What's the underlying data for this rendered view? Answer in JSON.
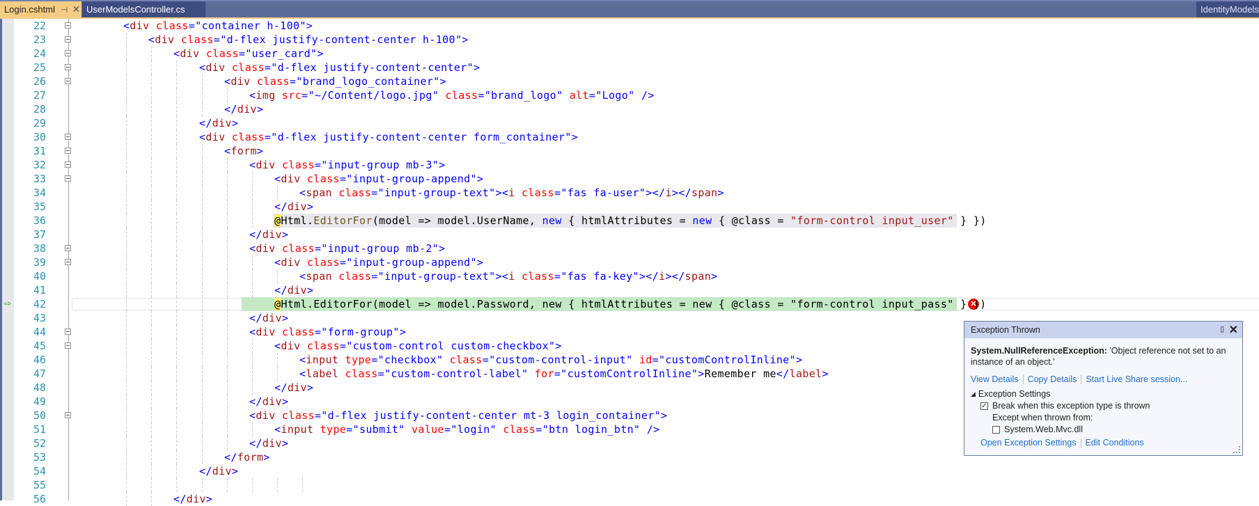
{
  "tabs": {
    "active": {
      "label": "Login.cshtml",
      "pin_icon": "pin-icon",
      "close_icon": "close-icon"
    },
    "second": {
      "label": "UserModelsController.cs"
    },
    "right": {
      "label": "IdentityModels.cs"
    }
  },
  "editor": {
    "current_line": 42,
    "lines": [
      {
        "n": "22",
        "indent": 0,
        "fold": true,
        "tokens": [
          [
            "tg",
            "<"
          ],
          [
            "tn",
            "div"
          ],
          [
            "at",
            " class"
          ],
          [
            "tg",
            "="
          ],
          [
            "av",
            "\"container h-100\""
          ],
          [
            "tg",
            ">"
          ]
        ]
      },
      {
        "n": "23",
        "indent": 1,
        "fold": true,
        "tokens": [
          [
            "tg",
            "<"
          ],
          [
            "tn",
            "div"
          ],
          [
            "at",
            " class"
          ],
          [
            "tg",
            "="
          ],
          [
            "av",
            "\"d-flex justify-content-center h-100\""
          ],
          [
            "tg",
            ">"
          ]
        ]
      },
      {
        "n": "24",
        "indent": 2,
        "fold": true,
        "tokens": [
          [
            "tg",
            "<"
          ],
          [
            "tn",
            "div"
          ],
          [
            "at",
            " class"
          ],
          [
            "tg",
            "="
          ],
          [
            "av",
            "\"user_card\""
          ],
          [
            "tg",
            ">"
          ]
        ]
      },
      {
        "n": "25",
        "indent": 3,
        "fold": true,
        "tokens": [
          [
            "tg",
            "<"
          ],
          [
            "tn",
            "div"
          ],
          [
            "at",
            " class"
          ],
          [
            "tg",
            "="
          ],
          [
            "av",
            "\"d-flex justify-content-center\""
          ],
          [
            "tg",
            ">"
          ]
        ]
      },
      {
        "n": "26",
        "indent": 4,
        "fold": true,
        "tokens": [
          [
            "tg",
            "<"
          ],
          [
            "tn",
            "div"
          ],
          [
            "at",
            " class"
          ],
          [
            "tg",
            "="
          ],
          [
            "av",
            "\"brand_logo_container\""
          ],
          [
            "tg",
            ">"
          ]
        ]
      },
      {
        "n": "27",
        "indent": 5,
        "fold": false,
        "tokens": [
          [
            "tg",
            "<"
          ],
          [
            "tn",
            "img"
          ],
          [
            "at",
            " src"
          ],
          [
            "tg",
            "="
          ],
          [
            "av",
            "\"~/Content/logo.jpg\""
          ],
          [
            "at",
            " class"
          ],
          [
            "tg",
            "="
          ],
          [
            "av",
            "\"brand_logo\""
          ],
          [
            "at",
            " alt"
          ],
          [
            "tg",
            "="
          ],
          [
            "av",
            "\"Logo\""
          ],
          [
            "tg",
            " />"
          ]
        ]
      },
      {
        "n": "28",
        "indent": 4,
        "fold": false,
        "tokens": [
          [
            "tg",
            "</"
          ],
          [
            "tn",
            "div"
          ],
          [
            "tg",
            ">"
          ]
        ]
      },
      {
        "n": "29",
        "indent": 3,
        "fold": false,
        "tokens": [
          [
            "tg",
            "</"
          ],
          [
            "tn",
            "div"
          ],
          [
            "tg",
            ">"
          ]
        ]
      },
      {
        "n": "30",
        "indent": 3,
        "fold": true,
        "tokens": [
          [
            "tg",
            "<"
          ],
          [
            "tn",
            "div"
          ],
          [
            "at",
            " class"
          ],
          [
            "tg",
            "="
          ],
          [
            "av",
            "\"d-flex justify-content-center form_container\""
          ],
          [
            "tg",
            ">"
          ]
        ]
      },
      {
        "n": "31",
        "indent": 4,
        "fold": true,
        "tokens": [
          [
            "tg",
            "<"
          ],
          [
            "tn",
            "form"
          ],
          [
            "tg",
            ">"
          ]
        ]
      },
      {
        "n": "32",
        "indent": 5,
        "fold": true,
        "tokens": [
          [
            "tg",
            "<"
          ],
          [
            "tn",
            "div"
          ],
          [
            "at",
            " class"
          ],
          [
            "tg",
            "="
          ],
          [
            "av",
            "\"input-group mb-3\""
          ],
          [
            "tg",
            ">"
          ]
        ]
      },
      {
        "n": "33",
        "indent": 6,
        "fold": true,
        "tokens": [
          [
            "tg",
            "<"
          ],
          [
            "tn",
            "div"
          ],
          [
            "at",
            " class"
          ],
          [
            "tg",
            "="
          ],
          [
            "av",
            "\"input-group-append\""
          ],
          [
            "tg",
            ">"
          ]
        ]
      },
      {
        "n": "34",
        "indent": 7,
        "fold": false,
        "tokens": [
          [
            "tg",
            "<"
          ],
          [
            "tn",
            "span"
          ],
          [
            "at",
            " class"
          ],
          [
            "tg",
            "="
          ],
          [
            "av",
            "\"input-group-text\""
          ],
          [
            "tg",
            ">"
          ],
          [
            "tg",
            "<"
          ],
          [
            "tn",
            "i"
          ],
          [
            "at",
            " class"
          ],
          [
            "tg",
            "="
          ],
          [
            "av",
            "\"fas fa-user\""
          ],
          [
            "tg",
            ">"
          ],
          [
            "tg",
            "</"
          ],
          [
            "tn",
            "i"
          ],
          [
            "tg",
            ">"
          ],
          [
            "tg",
            "</"
          ],
          [
            "tn",
            "span"
          ],
          [
            "tg",
            ">"
          ]
        ]
      },
      {
        "n": "35",
        "indent": 6,
        "fold": false,
        "tokens": [
          [
            "tg",
            "</"
          ],
          [
            "tn",
            "div"
          ],
          [
            "tg",
            ">"
          ]
        ]
      },
      {
        "n": "36",
        "indent": 6,
        "fold": false,
        "highlight": "grey",
        "tokens": [
          [
            "razor",
            "@"
          ],
          [
            "pl",
            "Html."
          ],
          [
            "mt",
            "EditorFor"
          ],
          [
            "pl",
            "(model => model.UserName, "
          ],
          [
            "kw",
            "new"
          ],
          [
            "pl",
            " { htmlAttributes = "
          ],
          [
            "kw",
            "new"
          ],
          [
            "pl",
            " { @class = "
          ],
          [
            "str",
            "\"form-control input_user\""
          ],
          [
            "pl",
            " } })"
          ]
        ]
      },
      {
        "n": "37",
        "indent": 5,
        "fold": false,
        "tokens": [
          [
            "tg",
            "</"
          ],
          [
            "tn",
            "div"
          ],
          [
            "tg",
            ">"
          ]
        ]
      },
      {
        "n": "38",
        "indent": 5,
        "fold": true,
        "tokens": [
          [
            "tg",
            "<"
          ],
          [
            "tn",
            "div"
          ],
          [
            "at",
            " class"
          ],
          [
            "tg",
            "="
          ],
          [
            "av",
            "\"input-group mb-2\""
          ],
          [
            "tg",
            ">"
          ]
        ]
      },
      {
        "n": "39",
        "indent": 6,
        "fold": true,
        "tokens": [
          [
            "tg",
            "<"
          ],
          [
            "tn",
            "div"
          ],
          [
            "at",
            " class"
          ],
          [
            "tg",
            "="
          ],
          [
            "av",
            "\"input-group-append\""
          ],
          [
            "tg",
            ">"
          ]
        ]
      },
      {
        "n": "40",
        "indent": 7,
        "fold": false,
        "tokens": [
          [
            "tg",
            "<"
          ],
          [
            "tn",
            "span"
          ],
          [
            "at",
            " class"
          ],
          [
            "tg",
            "="
          ],
          [
            "av",
            "\"input-group-text\""
          ],
          [
            "tg",
            ">"
          ],
          [
            "tg",
            "<"
          ],
          [
            "tn",
            "i"
          ],
          [
            "at",
            " class"
          ],
          [
            "tg",
            "="
          ],
          [
            "av",
            "\"fas fa-key\""
          ],
          [
            "tg",
            ">"
          ],
          [
            "tg",
            "</"
          ],
          [
            "tn",
            "i"
          ],
          [
            "tg",
            ">"
          ],
          [
            "tg",
            "</"
          ],
          [
            "tn",
            "span"
          ],
          [
            "tg",
            ">"
          ]
        ]
      },
      {
        "n": "41",
        "indent": 6,
        "fold": false,
        "tokens": [
          [
            "tg",
            "</"
          ],
          [
            "tn",
            "div"
          ],
          [
            "tg",
            ">"
          ]
        ]
      },
      {
        "n": "42",
        "indent": 6,
        "fold": false,
        "highlight": "green",
        "tokens": [
          [
            "razor",
            "@"
          ],
          [
            "pl",
            "Html.EditorFor(model => model.Password, new { htmlAttributes = new { @class = \"form-control input_pass\" } })"
          ]
        ]
      },
      {
        "n": "43",
        "indent": 5,
        "fold": false,
        "tokens": [
          [
            "tg",
            "</"
          ],
          [
            "tn",
            "div"
          ],
          [
            "tg",
            ">"
          ]
        ]
      },
      {
        "n": "44",
        "indent": 5,
        "fold": true,
        "tokens": [
          [
            "tg",
            "<"
          ],
          [
            "tn",
            "div"
          ],
          [
            "at",
            " class"
          ],
          [
            "tg",
            "="
          ],
          [
            "av",
            "\"form-group\""
          ],
          [
            "tg",
            ">"
          ]
        ]
      },
      {
        "n": "45",
        "indent": 6,
        "fold": true,
        "tokens": [
          [
            "tg",
            "<"
          ],
          [
            "tn",
            "div"
          ],
          [
            "at",
            " class"
          ],
          [
            "tg",
            "="
          ],
          [
            "av",
            "\"custom-control custom-checkbox\""
          ],
          [
            "tg",
            ">"
          ]
        ]
      },
      {
        "n": "46",
        "indent": 7,
        "fold": false,
        "tokens": [
          [
            "tg",
            "<"
          ],
          [
            "tn",
            "input"
          ],
          [
            "at",
            " type"
          ],
          [
            "tg",
            "="
          ],
          [
            "av",
            "\"checkbox\""
          ],
          [
            "at",
            " class"
          ],
          [
            "tg",
            "="
          ],
          [
            "av",
            "\"custom-control-input\""
          ],
          [
            "at",
            " id"
          ],
          [
            "tg",
            "="
          ],
          [
            "av",
            "\"customControlInline\""
          ],
          [
            "tg",
            ">"
          ]
        ]
      },
      {
        "n": "47",
        "indent": 7,
        "fold": false,
        "tokens": [
          [
            "tg",
            "<"
          ],
          [
            "tn",
            "label"
          ],
          [
            "at",
            " class"
          ],
          [
            "tg",
            "="
          ],
          [
            "av",
            "\"custom-control-label\""
          ],
          [
            "at",
            " for"
          ],
          [
            "tg",
            "="
          ],
          [
            "av",
            "\"customControlInline\""
          ],
          [
            "tg",
            ">"
          ],
          [
            "pl",
            "Remember me"
          ],
          [
            "tg",
            "</"
          ],
          [
            "tn",
            "label"
          ],
          [
            "tg",
            ">"
          ]
        ]
      },
      {
        "n": "48",
        "indent": 6,
        "fold": false,
        "tokens": [
          [
            "tg",
            "</"
          ],
          [
            "tn",
            "div"
          ],
          [
            "tg",
            ">"
          ]
        ]
      },
      {
        "n": "49",
        "indent": 5,
        "fold": false,
        "tokens": [
          [
            "tg",
            "</"
          ],
          [
            "tn",
            "div"
          ],
          [
            "tg",
            ">"
          ]
        ]
      },
      {
        "n": "50",
        "indent": 5,
        "fold": true,
        "tokens": [
          [
            "tg",
            "<"
          ],
          [
            "tn",
            "div"
          ],
          [
            "at",
            " class"
          ],
          [
            "tg",
            "="
          ],
          [
            "av",
            "\"d-flex justify-content-center mt-3 login_container\""
          ],
          [
            "tg",
            ">"
          ]
        ]
      },
      {
        "n": "51",
        "indent": 6,
        "fold": false,
        "tokens": [
          [
            "tg",
            "<"
          ],
          [
            "tn",
            "input"
          ],
          [
            "at",
            " type"
          ],
          [
            "tg",
            "="
          ],
          [
            "av",
            "\"submit\""
          ],
          [
            "at",
            " value"
          ],
          [
            "tg",
            "="
          ],
          [
            "av",
            "\"login\""
          ],
          [
            "at",
            " class"
          ],
          [
            "tg",
            "="
          ],
          [
            "av",
            "\"btn login_btn\""
          ],
          [
            "tg",
            " />"
          ]
        ]
      },
      {
        "n": "52",
        "indent": 5,
        "fold": false,
        "tokens": [
          [
            "tg",
            "</"
          ],
          [
            "tn",
            "div"
          ],
          [
            "tg",
            ">"
          ]
        ]
      },
      {
        "n": "53",
        "indent": 4,
        "fold": false,
        "tokens": [
          [
            "tg",
            "</"
          ],
          [
            "tn",
            "form"
          ],
          [
            "tg",
            ">"
          ]
        ]
      },
      {
        "n": "54",
        "indent": 3,
        "fold": false,
        "tokens": [
          [
            "tg",
            "</"
          ],
          [
            "tn",
            "div"
          ],
          [
            "tg",
            ">"
          ]
        ]
      },
      {
        "n": "55",
        "indent": 0,
        "fold": false,
        "tokens": []
      },
      {
        "n": "56",
        "indent": 2,
        "fold": false,
        "tokens": [
          [
            "tg",
            "</"
          ],
          [
            "tn",
            "div"
          ],
          [
            "tg",
            ">"
          ]
        ]
      }
    ]
  },
  "exception_popup": {
    "title": "Exception Thrown",
    "exception_type": "System.NullReferenceException:",
    "message": " 'Object reference not set to an instance of an object.'",
    "links": [
      "View Details",
      "Copy Details",
      "Start Live Share session..."
    ],
    "settings_header": "Exception Settings",
    "break_label": "Break when this exception type is thrown",
    "break_checked": true,
    "except_label": "Except when thrown from:",
    "module_label": "System.Web.Mvc.dll",
    "module_checked": false,
    "footer_links": [
      "Open Exception Settings",
      "Edit Conditions"
    ]
  },
  "colors": {
    "tab_active": "#f5cc84",
    "tab_strip": "#5d6b99",
    "current_statement": "#c5e8c5",
    "error": "#e51400",
    "line_number": "#2b91af"
  }
}
